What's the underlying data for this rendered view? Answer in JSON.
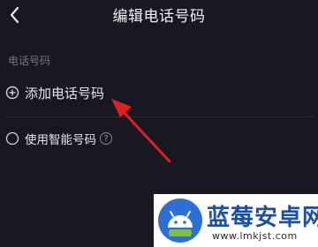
{
  "header": {
    "back_icon": "chevron-left-icon",
    "title": "编辑电话号码"
  },
  "section": {
    "label": "电话号码"
  },
  "actions": {
    "add_icon": "plus-circle-icon",
    "add_label": "添加电话号码",
    "smart_radio_icon": "radio-unchecked-icon",
    "smart_label": "使用智能号码",
    "help_icon": "question-circle-icon",
    "help_glyph": "?"
  },
  "annotation": {
    "arrow_color": "#e02020"
  },
  "watermark": {
    "logo": "android-robot-logo",
    "text": "蓝莓安卓网",
    "url": "www.lmkjst.com"
  },
  "colors": {
    "background": "#181822",
    "text": "#e8e8ee",
    "muted": "#74747e",
    "watermark_text": "#1f4fa0"
  }
}
